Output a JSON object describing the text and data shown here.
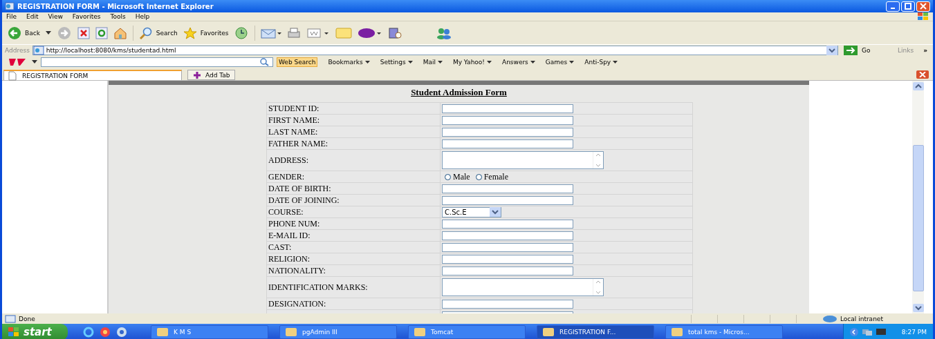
{
  "window": {
    "title": "REGISTRATION FORM - Microsoft Internet Explorer"
  },
  "menu": [
    "File",
    "Edit",
    "View",
    "Favorites",
    "Tools",
    "Help"
  ],
  "toolbar": {
    "back": "Back",
    "search": "Search",
    "favorites": "Favorites"
  },
  "address": {
    "label": "Address",
    "url": "http://localhost:8080/kms/studentad.html",
    "go": "Go",
    "links": "Links",
    "more": "»"
  },
  "yahoo_bar": {
    "search_button": "Web Search",
    "items": [
      "Bookmarks",
      "Settings",
      "Mail",
      "My Yahoo!",
      "Answers",
      "Games",
      "Anti-Spy"
    ]
  },
  "tabs": [
    {
      "label": "REGISTRATION FORM",
      "selected": true
    }
  ],
  "add_tab": "Add Tab",
  "form": {
    "title": "Student Admission Form",
    "rows": [
      {
        "label": "STUDENT ID:",
        "kind": "text"
      },
      {
        "label": "FIRST NAME:",
        "kind": "text"
      },
      {
        "label": "LAST NAME:",
        "kind": "text"
      },
      {
        "label": "FATHER NAME:",
        "kind": "text"
      },
      {
        "label": "ADDRESS:",
        "kind": "textarea"
      },
      {
        "label": "GENDER:",
        "kind": "radio",
        "options": [
          {
            "label": "Male",
            "selected": false
          },
          {
            "label": "Female",
            "selected": false
          }
        ]
      },
      {
        "label": "DATE OF BIRTH:",
        "kind": "text"
      },
      {
        "label": "DATE OF JOINING:",
        "kind": "text"
      },
      {
        "label": "COURSE:",
        "kind": "select",
        "value": "C.Sc.E"
      },
      {
        "label": "PHONE NUM:",
        "kind": "text"
      },
      {
        "label": "E-MAIL ID:",
        "kind": "text"
      },
      {
        "label": "CAST:",
        "kind": "text"
      },
      {
        "label": "RELIGION:",
        "kind": "text"
      },
      {
        "label": "NATIONALITY:",
        "kind": "text"
      },
      {
        "label": "IDENTIFICATION MARKS:",
        "kind": "textarea"
      },
      {
        "label": "DESIGNATION:",
        "kind": "text"
      },
      {
        "label": "",
        "kind": "text"
      }
    ]
  },
  "status_bar": {
    "text": "Done",
    "zone": "Local intranet"
  },
  "taskbar": {
    "start": "start",
    "buttons": [
      {
        "label": "K M S",
        "selected": false
      },
      {
        "label": "pgAdmin III",
        "selected": false
      },
      {
        "label": "Tomcat",
        "selected": false
      },
      {
        "label": "REGISTRATION F...",
        "selected": true
      },
      {
        "label": "total kms - Micros...",
        "selected": false
      }
    ],
    "clock": "8:27 PM"
  }
}
